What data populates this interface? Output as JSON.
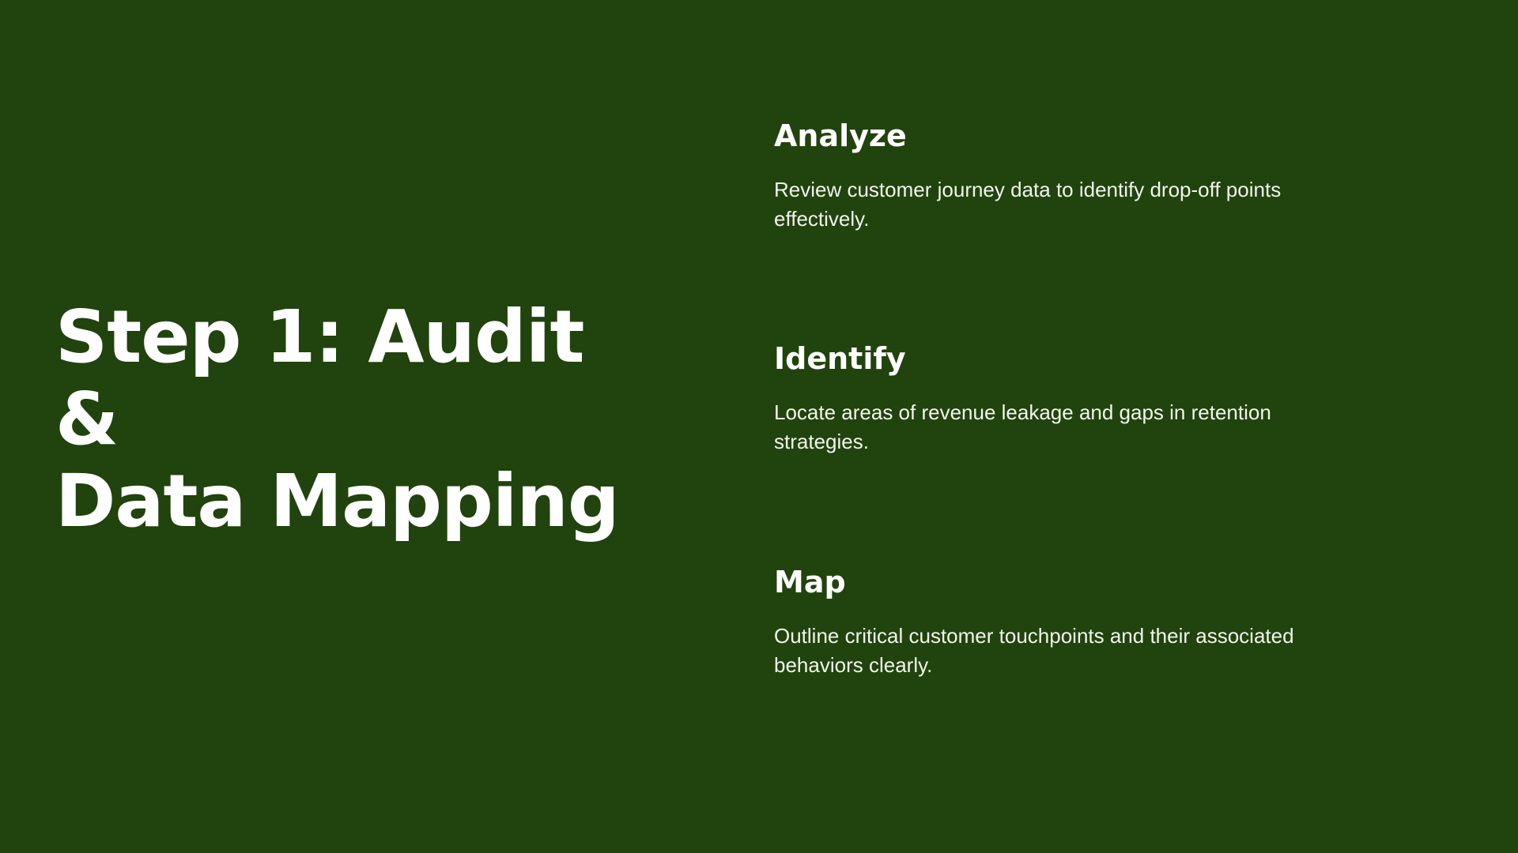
{
  "slide": {
    "title_line1": "Step 1: Audit &",
    "title_line2": "Data Mapping",
    "items": [
      {
        "heading": "Analyze",
        "text": "Review customer journey data to identify drop-off points effectively."
      },
      {
        "heading": "Identify",
        "text": "Locate areas of revenue leakage and gaps in retention strategies."
      },
      {
        "heading": "Map",
        "text": "Outline critical customer touchpoints and their associated behaviors clearly."
      }
    ]
  },
  "colors": {
    "background": "#21430d",
    "text": "#ffffff"
  }
}
